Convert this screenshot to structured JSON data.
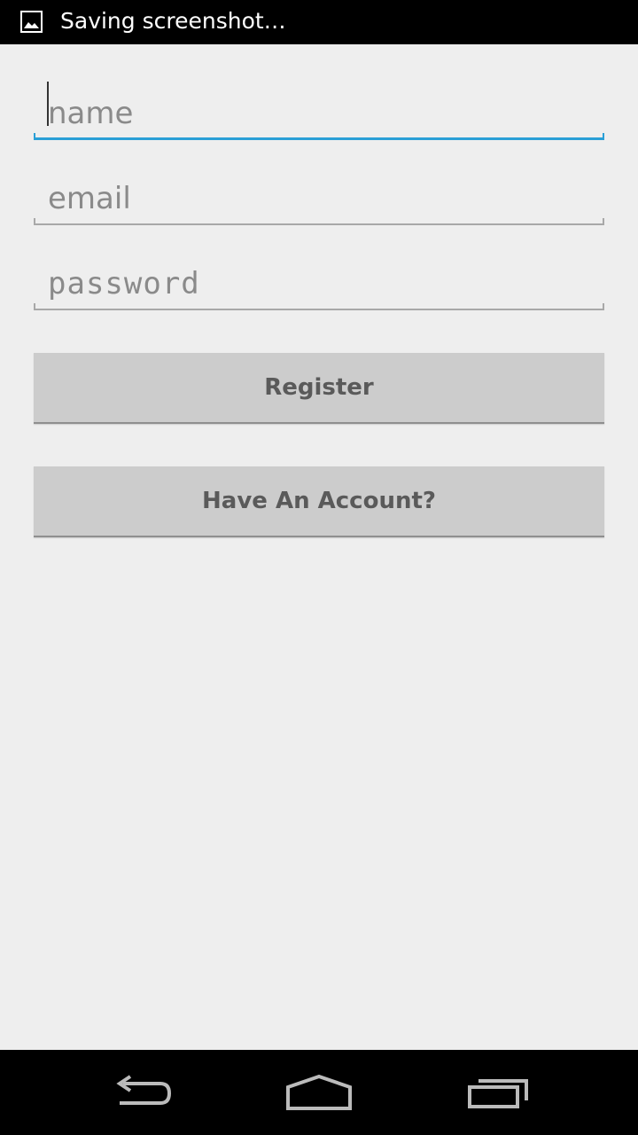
{
  "status_bar": {
    "notification_icon": "image-icon",
    "text": "Saving screenshot…"
  },
  "form": {
    "name": {
      "placeholder": "name",
      "value": ""
    },
    "email": {
      "placeholder": "email",
      "value": ""
    },
    "password": {
      "placeholder": "password",
      "value": ""
    }
  },
  "buttons": {
    "register_label": "Register",
    "have_account_label": "Have An Account?"
  },
  "nav_bar": {
    "back_icon": "back-icon",
    "home_icon": "home-icon",
    "recents_icon": "recents-icon"
  },
  "colors": {
    "accent": "#2a9fd6",
    "background": "#eeeeee",
    "button": "#cccccc",
    "system_bars": "#000000"
  }
}
